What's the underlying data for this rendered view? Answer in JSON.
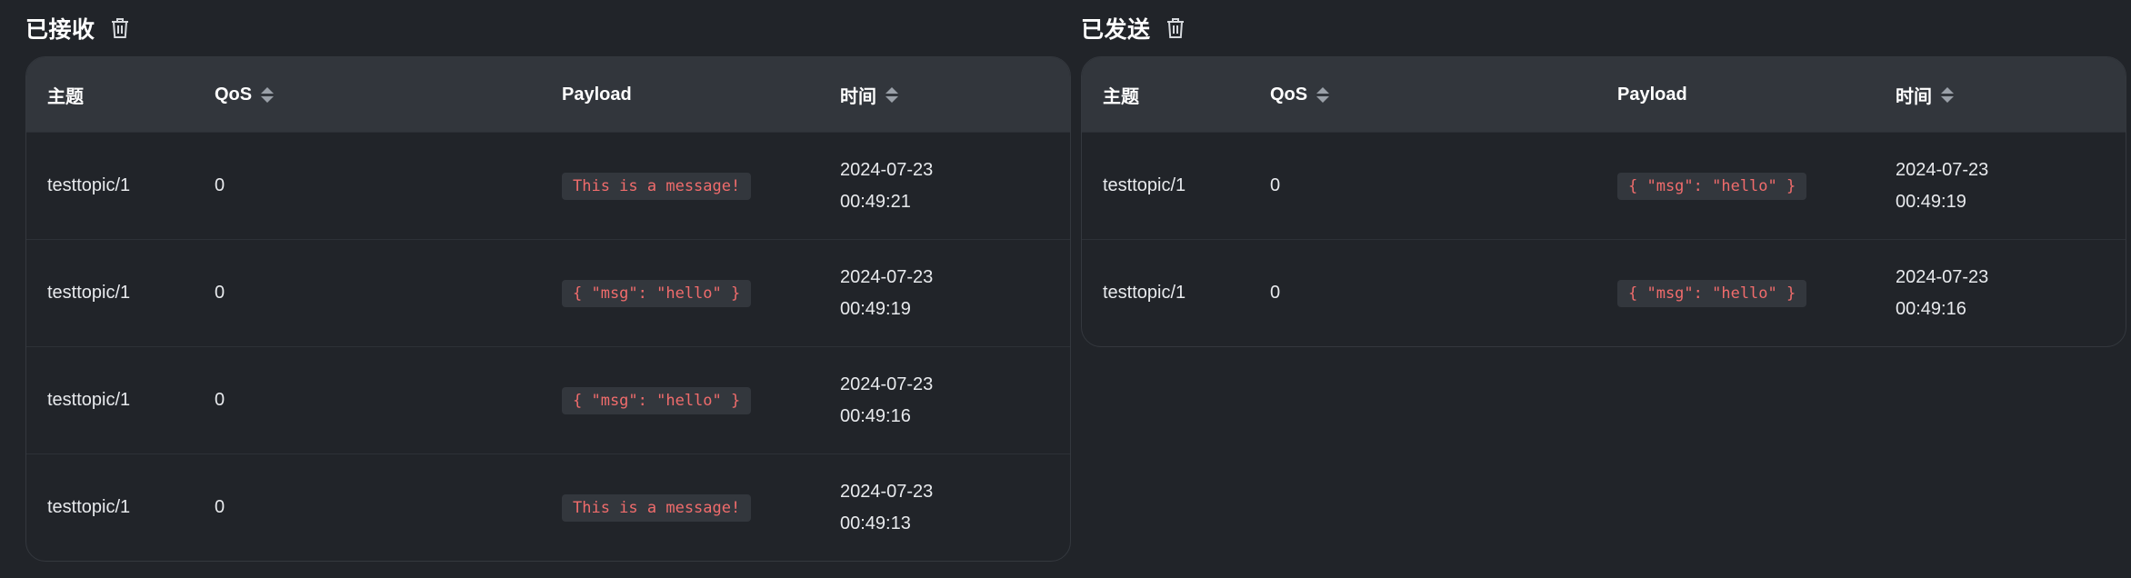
{
  "received": {
    "title": "已接收",
    "columns": {
      "topic": "主题",
      "qos": "QoS",
      "payload": "Payload",
      "time": "时间"
    },
    "rows": [
      {
        "topic": "testtopic/1",
        "qos": "0",
        "payload": "This is a message!",
        "date": "2024-07-23",
        "clock": "00:49:21"
      },
      {
        "topic": "testtopic/1",
        "qos": "0",
        "payload": "{ \"msg\": \"hello\" }",
        "date": "2024-07-23",
        "clock": "00:49:19"
      },
      {
        "topic": "testtopic/1",
        "qos": "0",
        "payload": "{ \"msg\": \"hello\" }",
        "date": "2024-07-23",
        "clock": "00:49:16"
      },
      {
        "topic": "testtopic/1",
        "qos": "0",
        "payload": "This is a message!",
        "date": "2024-07-23",
        "clock": "00:49:13"
      }
    ]
  },
  "sent": {
    "title": "已发送",
    "columns": {
      "topic": "主题",
      "qos": "QoS",
      "payload": "Payload",
      "time": "时间"
    },
    "rows": [
      {
        "topic": "testtopic/1",
        "qos": "0",
        "payload": "{ \"msg\": \"hello\" }",
        "date": "2024-07-23",
        "clock": "00:49:19"
      },
      {
        "topic": "testtopic/1",
        "qos": "0",
        "payload": "{ \"msg\": \"hello\" }",
        "date": "2024-07-23",
        "clock": "00:49:16"
      }
    ]
  },
  "icons": {
    "clear": "trash-icon",
    "sort": "sort-icon"
  },
  "colors": {
    "background": "#212429",
    "header": "#32363c",
    "payload_text": "#f06c6c",
    "payload_bg": "#33373d"
  }
}
